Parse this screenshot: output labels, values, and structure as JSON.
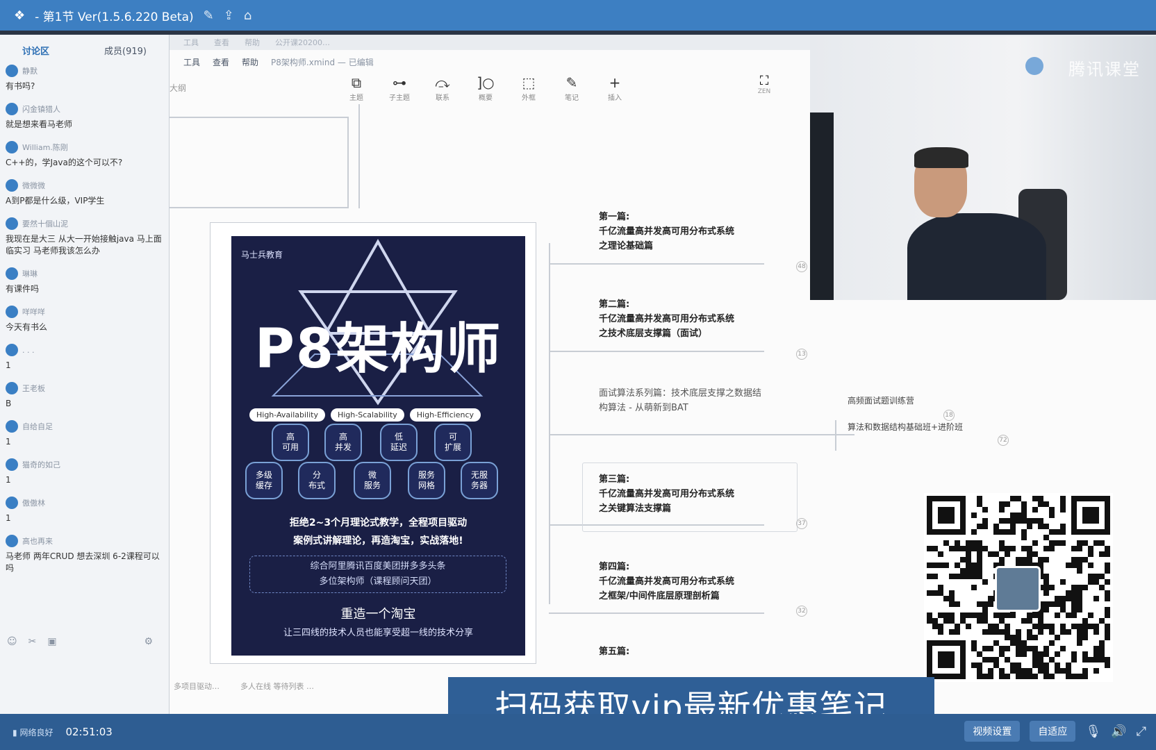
{
  "titlebar": {
    "title": "- 第1节 Ver(1.5.6.220 Beta)"
  },
  "chat": {
    "tab_discussion": "讨论区",
    "tab_members": "成员(919)",
    "messages": [
      {
        "user": "静默",
        "text": "有书吗?"
      },
      {
        "user": "闪金镇猎人",
        "text": "就是想来看马老师"
      },
      {
        "user": "William.陈刚",
        "text": "C++的，学Java的这个可以不?"
      },
      {
        "user": "微微微",
        "text": "A到P都是什么级，VIP学生"
      },
      {
        "user": "要然十個山泥",
        "text": "我现在是大三 从大一开始接触java 马上面临实习 马老师我该怎么办"
      },
      {
        "user": "琳琳",
        "text": "有课件吗"
      },
      {
        "user": "咩咩咩",
        "text": "今天有书么"
      },
      {
        "user": ". . .",
        "text": "1"
      },
      {
        "user": "王老板",
        "text": "B"
      },
      {
        "user": "自给自足",
        "text": "1"
      },
      {
        "user": "猫奇的如己",
        "text": "1"
      },
      {
        "user": "傲傲林",
        "text": "1"
      },
      {
        "user": "高也再来",
        "text": "马老师 两年CRUD 想去深圳 6-2课程可以吗"
      }
    ]
  },
  "app": {
    "ghost_menu": [
      "工具",
      "查看",
      "帮助",
      "公开课20200…"
    ],
    "menu": [
      "工具",
      "查看",
      "帮助"
    ],
    "filename": "P8架构师.xmind — 已编辑",
    "outline_label": "大纲",
    "toolbar": [
      {
        "icon": "⧉",
        "label": "主题"
      },
      {
        "icon": "⊶",
        "label": "子主题"
      },
      {
        "icon": "⤼",
        "label": "联系"
      },
      {
        "icon": "]○",
        "label": "概要"
      },
      {
        "icon": "⬚",
        "label": "外框"
      },
      {
        "icon": "✎",
        "label": "笔记"
      },
      {
        "icon": "+",
        "label": "插入"
      }
    ],
    "fullscreen_label": "ZEN"
  },
  "poster": {
    "brand": "马士兵教育",
    "headline": "P8架构师",
    "pills": [
      "High-Availability",
      "High-Scalability",
      "High-Efficiency"
    ],
    "hexes": [
      "高\n可用",
      "高\n并发",
      "低\n延迟",
      "可\n扩展",
      "多级\n缓存",
      "分\n布式",
      "微\n服务",
      "服务\n网格",
      "无服\n务器"
    ],
    "slogan1": "拒绝2~3个月理论式教学，全程项目驱动",
    "slogan2": "案例式讲解理论，再造淘宝，实战落地!",
    "box1": "综合阿里腾讯百度美团拼多多头条",
    "box2": "多位架构师（课程顾问天团）",
    "head2": "重造一个淘宝",
    "sub2": "让三四线的技术人员也能享受超一线的技术分享"
  },
  "mindmap": {
    "nodes": [
      {
        "line1": "第一篇:",
        "line2": "千亿流量高并发高可用分布式系统",
        "line3": "之理论基础篇",
        "count": "48"
      },
      {
        "line1": "第二篇:",
        "line2": "千亿流量高并发高可用分布式系统",
        "line3": "之技术底层支撑篇（面试）",
        "count": "13"
      },
      {
        "line1": "面试算法系列篇：技术底层支撑之数据结",
        "line2": "构算法 - 从萌新到BAT",
        "line3": "",
        "count": ""
      },
      {
        "line1": "第三篇:",
        "line2": "千亿流量高并发高可用分布式系统",
        "line3": "之关键算法支撑篇",
        "count": "37"
      },
      {
        "line1": "第四篇:",
        "line2": "千亿流量高并发高可用分布式系统",
        "line3": "之框架/中间件底层原理剖析篇",
        "count": "32"
      },
      {
        "line1": "第五篇:",
        "line2": "",
        "line3": "",
        "count": ""
      }
    ],
    "sub_nodes": [
      {
        "label": "高频面试题训练营",
        "count": "18"
      },
      {
        "label": "算法和数据结构基础班+进阶班",
        "count": "72"
      }
    ]
  },
  "video": {
    "watermark": "腾讯课堂"
  },
  "banner": {
    "text": "扫码获取vip最新优惠笔记"
  },
  "bottom_ghost": [
    "多项目驱动…",
    "多人在线 等待列表 …"
  ],
  "status": {
    "network": "网络良好",
    "time": "02:51:03",
    "video_settings": "视频设置",
    "fit": "自适应"
  },
  "colors": {
    "titlebar": "#3d7fc2",
    "statusbar": "#2e5d92",
    "poster": "#1a1f45"
  }
}
